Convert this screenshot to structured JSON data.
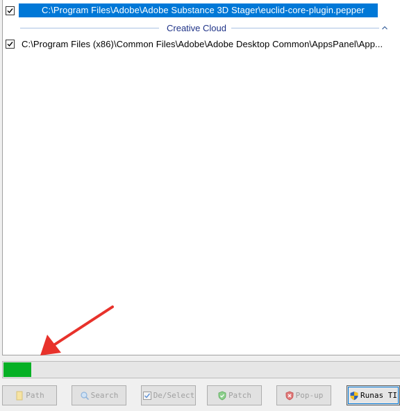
{
  "list": {
    "rows": [
      {
        "checked": true,
        "selected": true,
        "path": "C:\\Program Files\\Adobe\\Adobe Substance 3D Stager\\euclid-core-plugin.pepper"
      }
    ],
    "group": {
      "title": "Creative Cloud",
      "rows": [
        {
          "checked": true,
          "selected": false,
          "path": "C:\\Program Files (x86)\\Common Files\\Adobe\\Adobe Desktop Common\\AppsPanel\\App..."
        }
      ]
    }
  },
  "progress": {
    "value": 0.07,
    "color": "#06b025"
  },
  "buttons": {
    "path": "Path",
    "search": "Search",
    "deselect": "De/Select",
    "patch": "Patch",
    "popup": "Pop-up",
    "runas": "Runas TI"
  },
  "colors": {
    "selection": "#0078d7",
    "group_title": "#1e3287",
    "arrow": "#e8322b"
  }
}
